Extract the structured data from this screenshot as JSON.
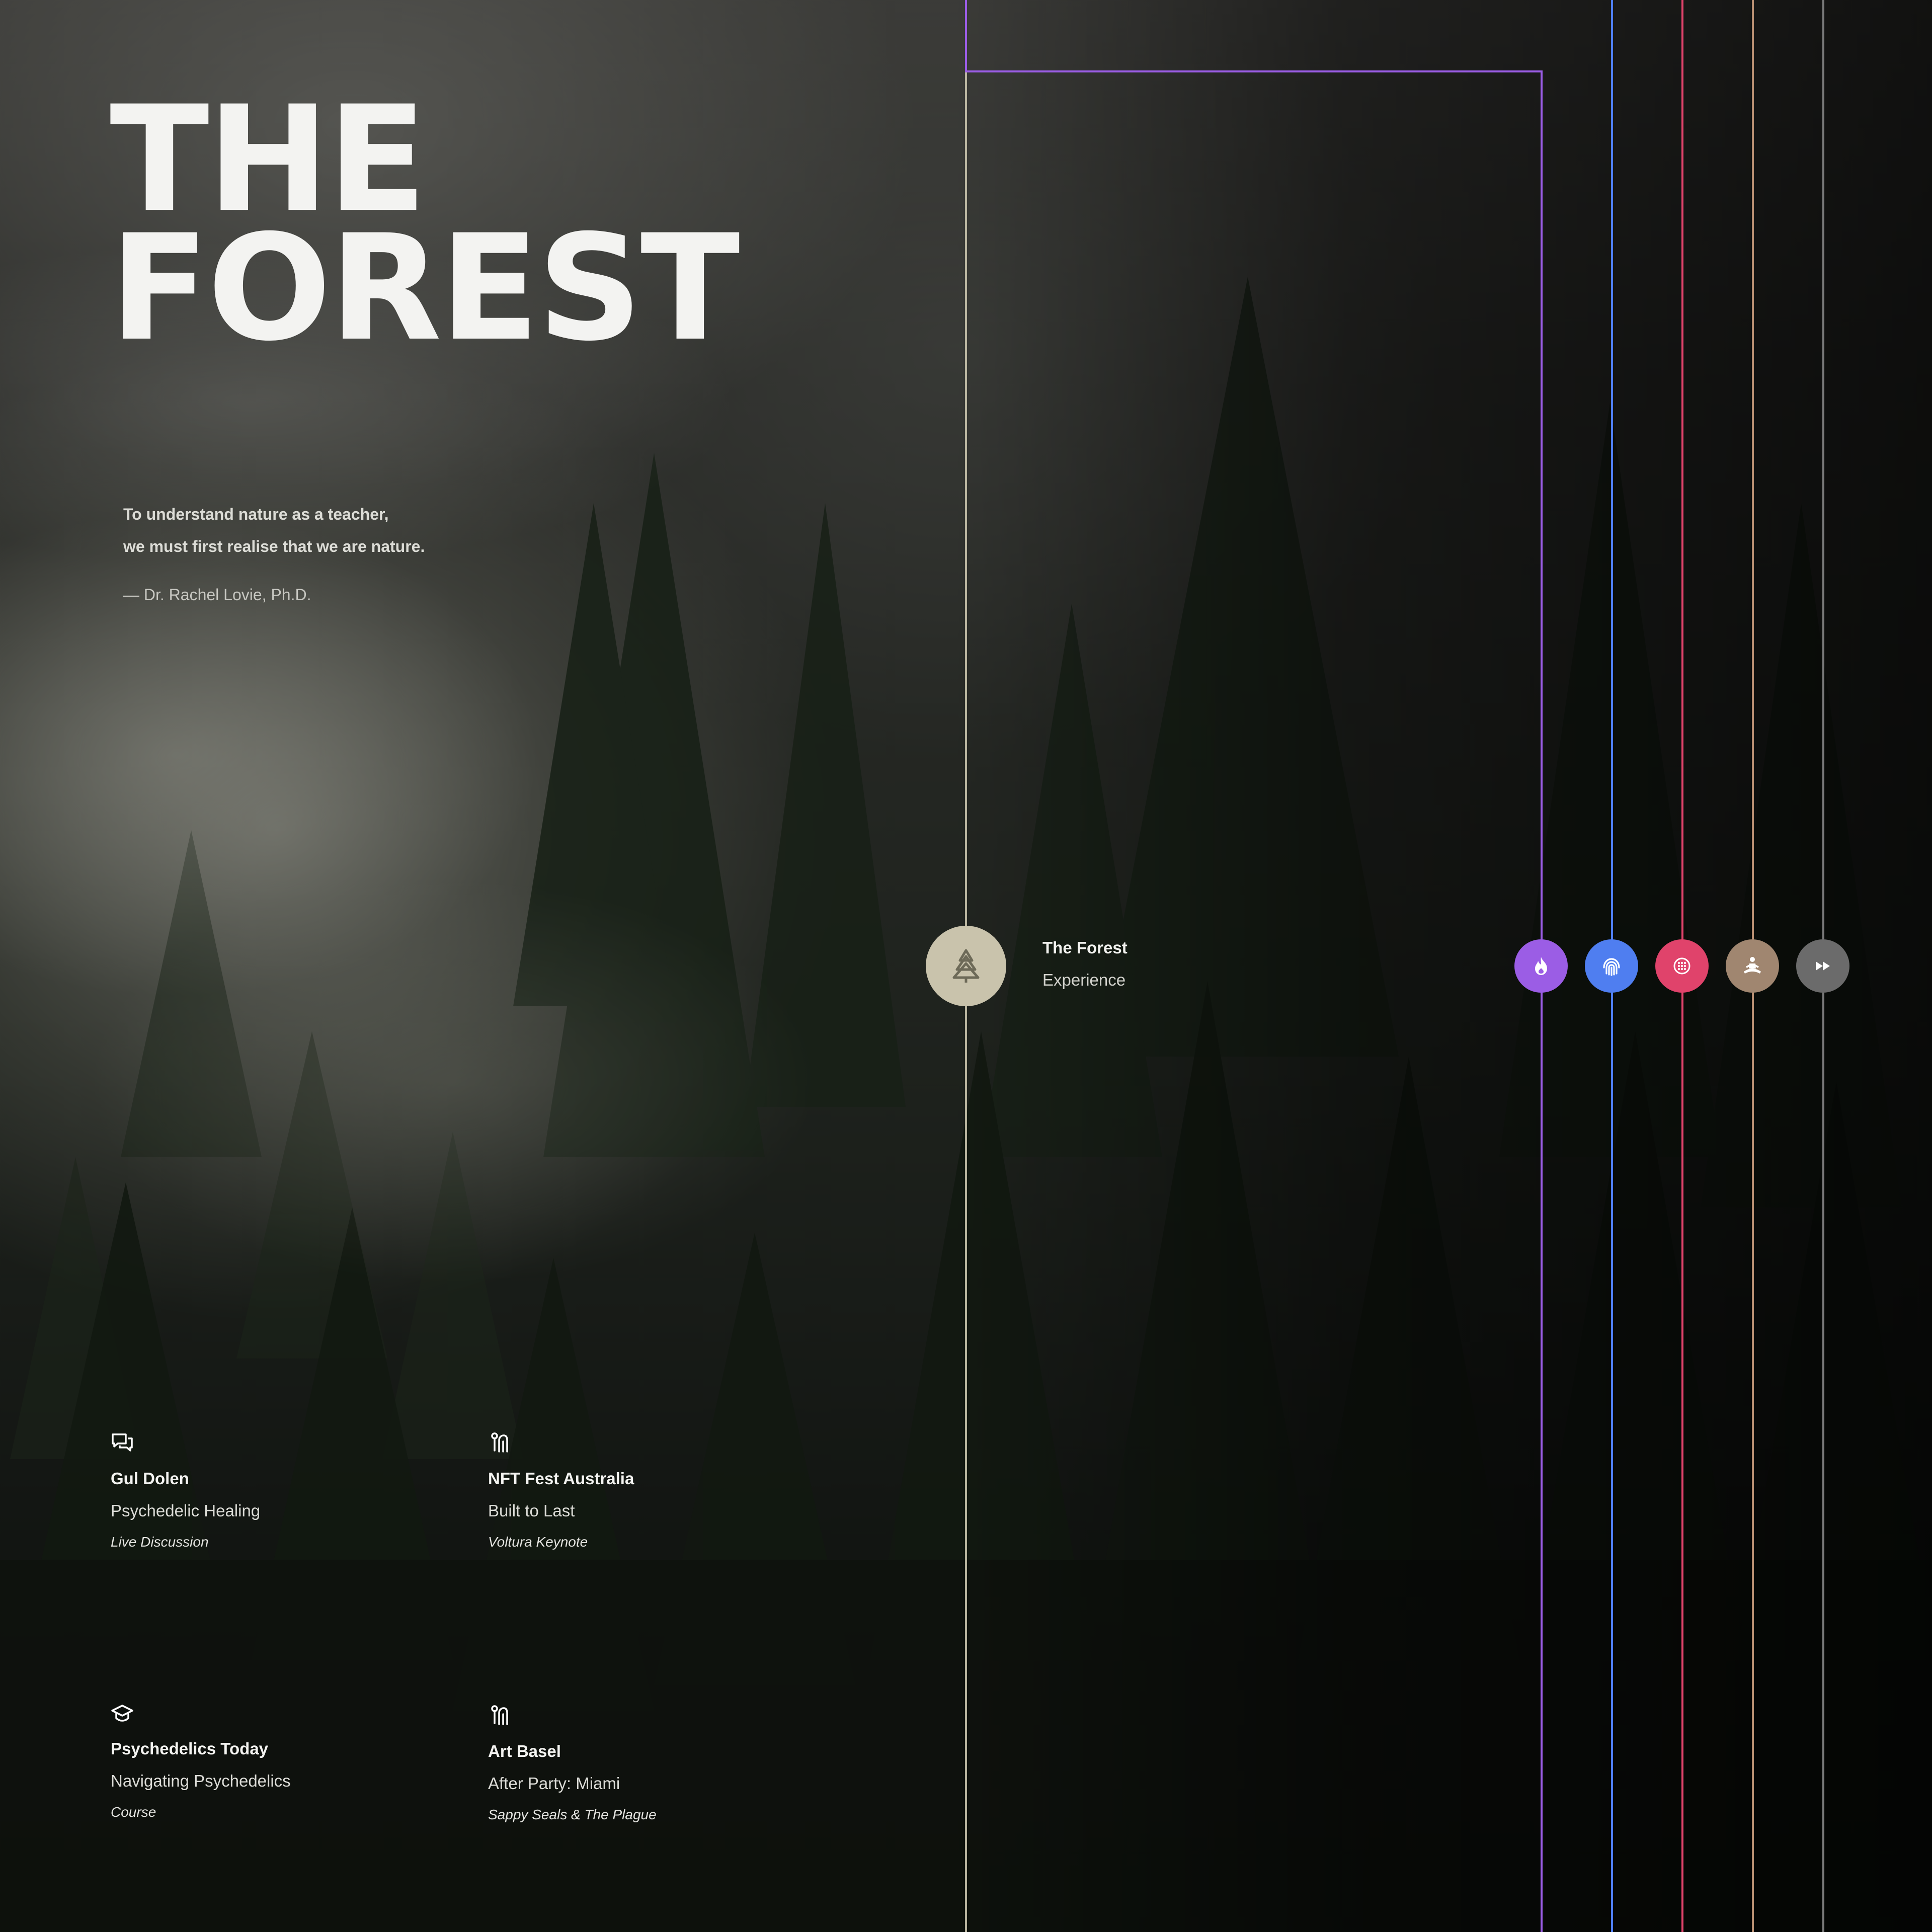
{
  "page": {
    "title_line1": "THE",
    "title_line2": "FOREST"
  },
  "quote": {
    "line1": "To understand nature as a teacher,",
    "line2": "we must first realise that we are nature.",
    "author": "— Dr. Rachel Lovie, Ph.D."
  },
  "timeline": {
    "main_node": {
      "icon": "tree-icon",
      "name": "The Forest",
      "subtitle": "Experience",
      "color": "#c9c3ac"
    },
    "nodes": [
      {
        "icon": "flame-icon",
        "color": "#9b5de5"
      },
      {
        "icon": "fingerprint-icon",
        "color": "#4f7ef0"
      },
      {
        "icon": "dotted-circle-icon",
        "color": "#e0436b"
      },
      {
        "icon": "meditation-icon",
        "color": "#a08670"
      },
      {
        "icon": "fast-forward-icon",
        "color": "#6b6b6b"
      }
    ]
  },
  "events": [
    {
      "icon": "chat-icon",
      "title": "Gul Dolen",
      "subtitle": "Psychedelic Healing",
      "type": "Live Discussion"
    },
    {
      "icon": "microphone-icon",
      "title": "NFT Fest Australia",
      "subtitle": "Built to Last",
      "type": "Voltura Keynote"
    },
    {
      "icon": "graduation-cap-icon",
      "title": "Psychedelics Today",
      "subtitle": "Navigating Psychedelics",
      "type": "Course"
    },
    {
      "icon": "microphone-icon",
      "title": "Art Basel",
      "subtitle": "After Party: Miami",
      "type": "Sappy Seals & The Plague"
    }
  ]
}
